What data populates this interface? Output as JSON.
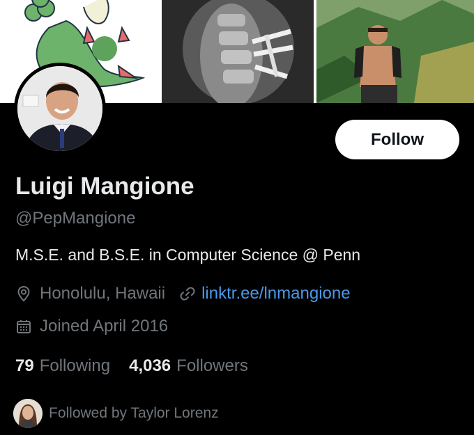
{
  "banner": {
    "images": [
      {
        "subject": "cartoon-creature-illustration"
      },
      {
        "subject": "spine-xray-with-screws"
      },
      {
        "subject": "shirtless-hiker-on-trail"
      }
    ]
  },
  "avatar": {
    "subject": "profile-photo-man-in-suit"
  },
  "follow_button": {
    "label": "Follow"
  },
  "profile": {
    "display_name": "Luigi Mangione",
    "handle": "@PepMangione",
    "bio": "M.S.E. and B.S.E. in Computer Science @ Penn",
    "location": "Honolulu, Hawaii",
    "link": "linktr.ee/lnmangione",
    "joined": "Joined April 2016"
  },
  "stats": {
    "following_count": "79",
    "following_label": "Following",
    "followers_count": "4,036",
    "followers_label": "Followers"
  },
  "followed_by": {
    "text": "Followed by Taylor Lorenz"
  },
  "icons": {
    "location": "location-pin-icon",
    "link": "link-icon",
    "calendar": "calendar-icon"
  },
  "colors": {
    "background": "#000000",
    "primary_text": "#e7e9ea",
    "secondary_text": "#71767b",
    "link": "#4a99e9",
    "button_bg": "#ffffff",
    "button_text": "#0f1419"
  }
}
